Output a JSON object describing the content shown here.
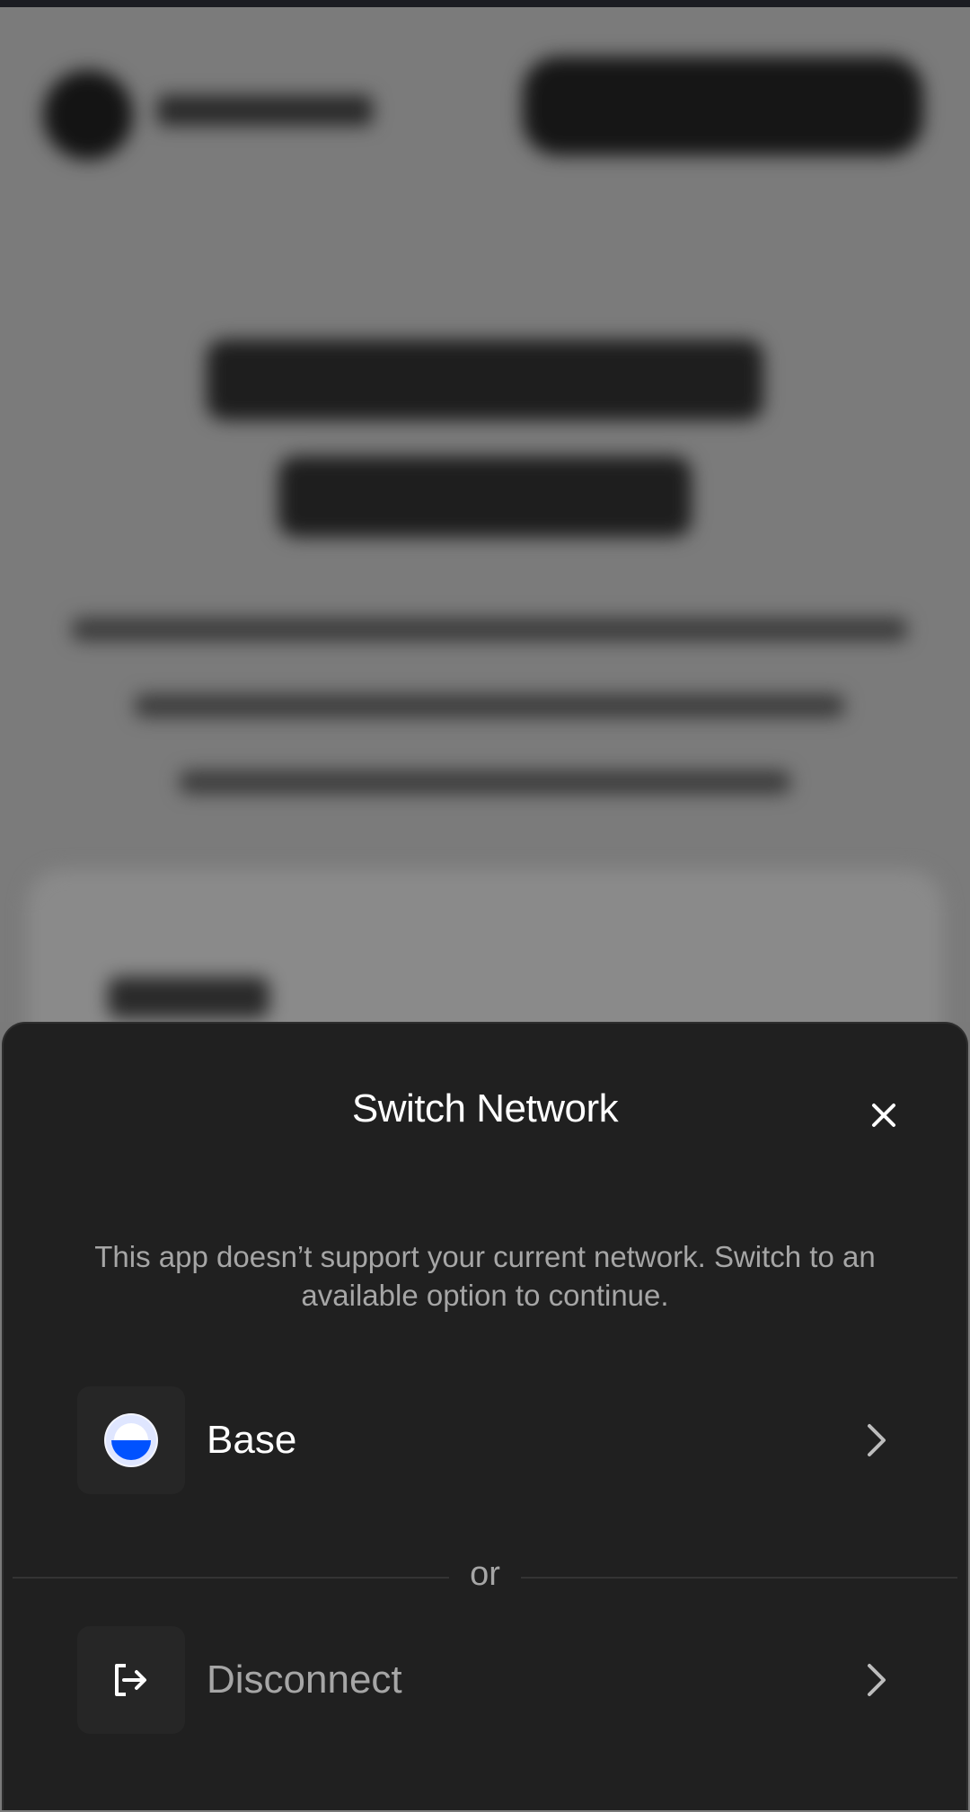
{
  "modal": {
    "title": "Switch Network",
    "description": "This app doesn’t support your current network. Switch to an available option to continue.",
    "options": [
      {
        "label": "Base",
        "icon": "base-network-icon"
      },
      {
        "label": "Disconnect",
        "icon": "disconnect-icon"
      }
    ],
    "separator": "or"
  },
  "colors": {
    "sheet_bg": "#202020",
    "title_text": "#ffffff",
    "muted_text": "#a6a6a6",
    "base_blue": "#0052ff"
  }
}
